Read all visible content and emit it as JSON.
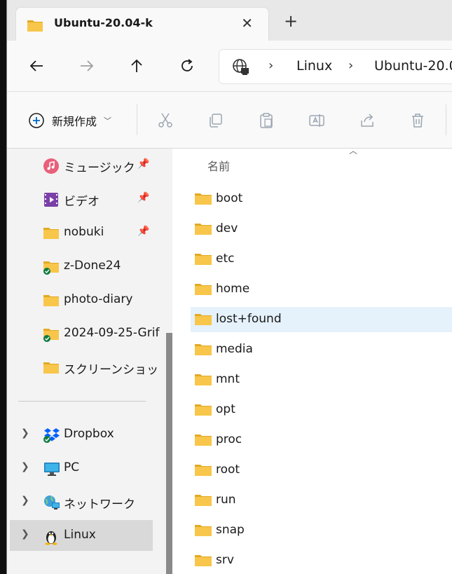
{
  "tab": {
    "title": "Ubuntu-20.04-k",
    "close_glyph": "✕",
    "new_tab_glyph": "+"
  },
  "address": {
    "segments": [
      "Linux",
      "Ubuntu-20.0"
    ]
  },
  "command_bar": {
    "new_label": "新規作成"
  },
  "nav_pane": {
    "quick_access": [
      {
        "label": "ミュージック",
        "icon": "music-icon",
        "pinned": true
      },
      {
        "label": "ビデオ",
        "icon": "video-icon",
        "pinned": true
      },
      {
        "label": "nobuki",
        "icon": "folder-icon",
        "pinned": true
      },
      {
        "label": "z-Done24",
        "icon": "synced-folder-icon",
        "pinned": false
      },
      {
        "label": "photo-diary",
        "icon": "folder-icon",
        "pinned": false
      },
      {
        "label": "2024-09-25-Grif",
        "icon": "synced-folder-icon",
        "pinned": false
      },
      {
        "label": "スクリーンショット",
        "icon": "folder-icon",
        "pinned": false
      }
    ],
    "locations": [
      {
        "label": "Dropbox",
        "icon": "dropbox-icon"
      },
      {
        "label": "PC",
        "icon": "pc-icon"
      },
      {
        "label": "ネットワーク",
        "icon": "network-icon"
      },
      {
        "label": "Linux",
        "icon": "linux-penguin-icon",
        "selected": true
      }
    ]
  },
  "content": {
    "column_header": "名前",
    "items": [
      "boot",
      "dev",
      "etc",
      "home",
      "lost+found",
      "media",
      "mnt",
      "opt",
      "proc",
      "root",
      "run",
      "snap",
      "srv"
    ],
    "hovered_item": "lost+found"
  },
  "colors": {
    "folder": "#f8c64a",
    "folder_dark": "#e2a923",
    "hover": "#e5f1fb",
    "selected_nav": "#d9d9d9"
  }
}
